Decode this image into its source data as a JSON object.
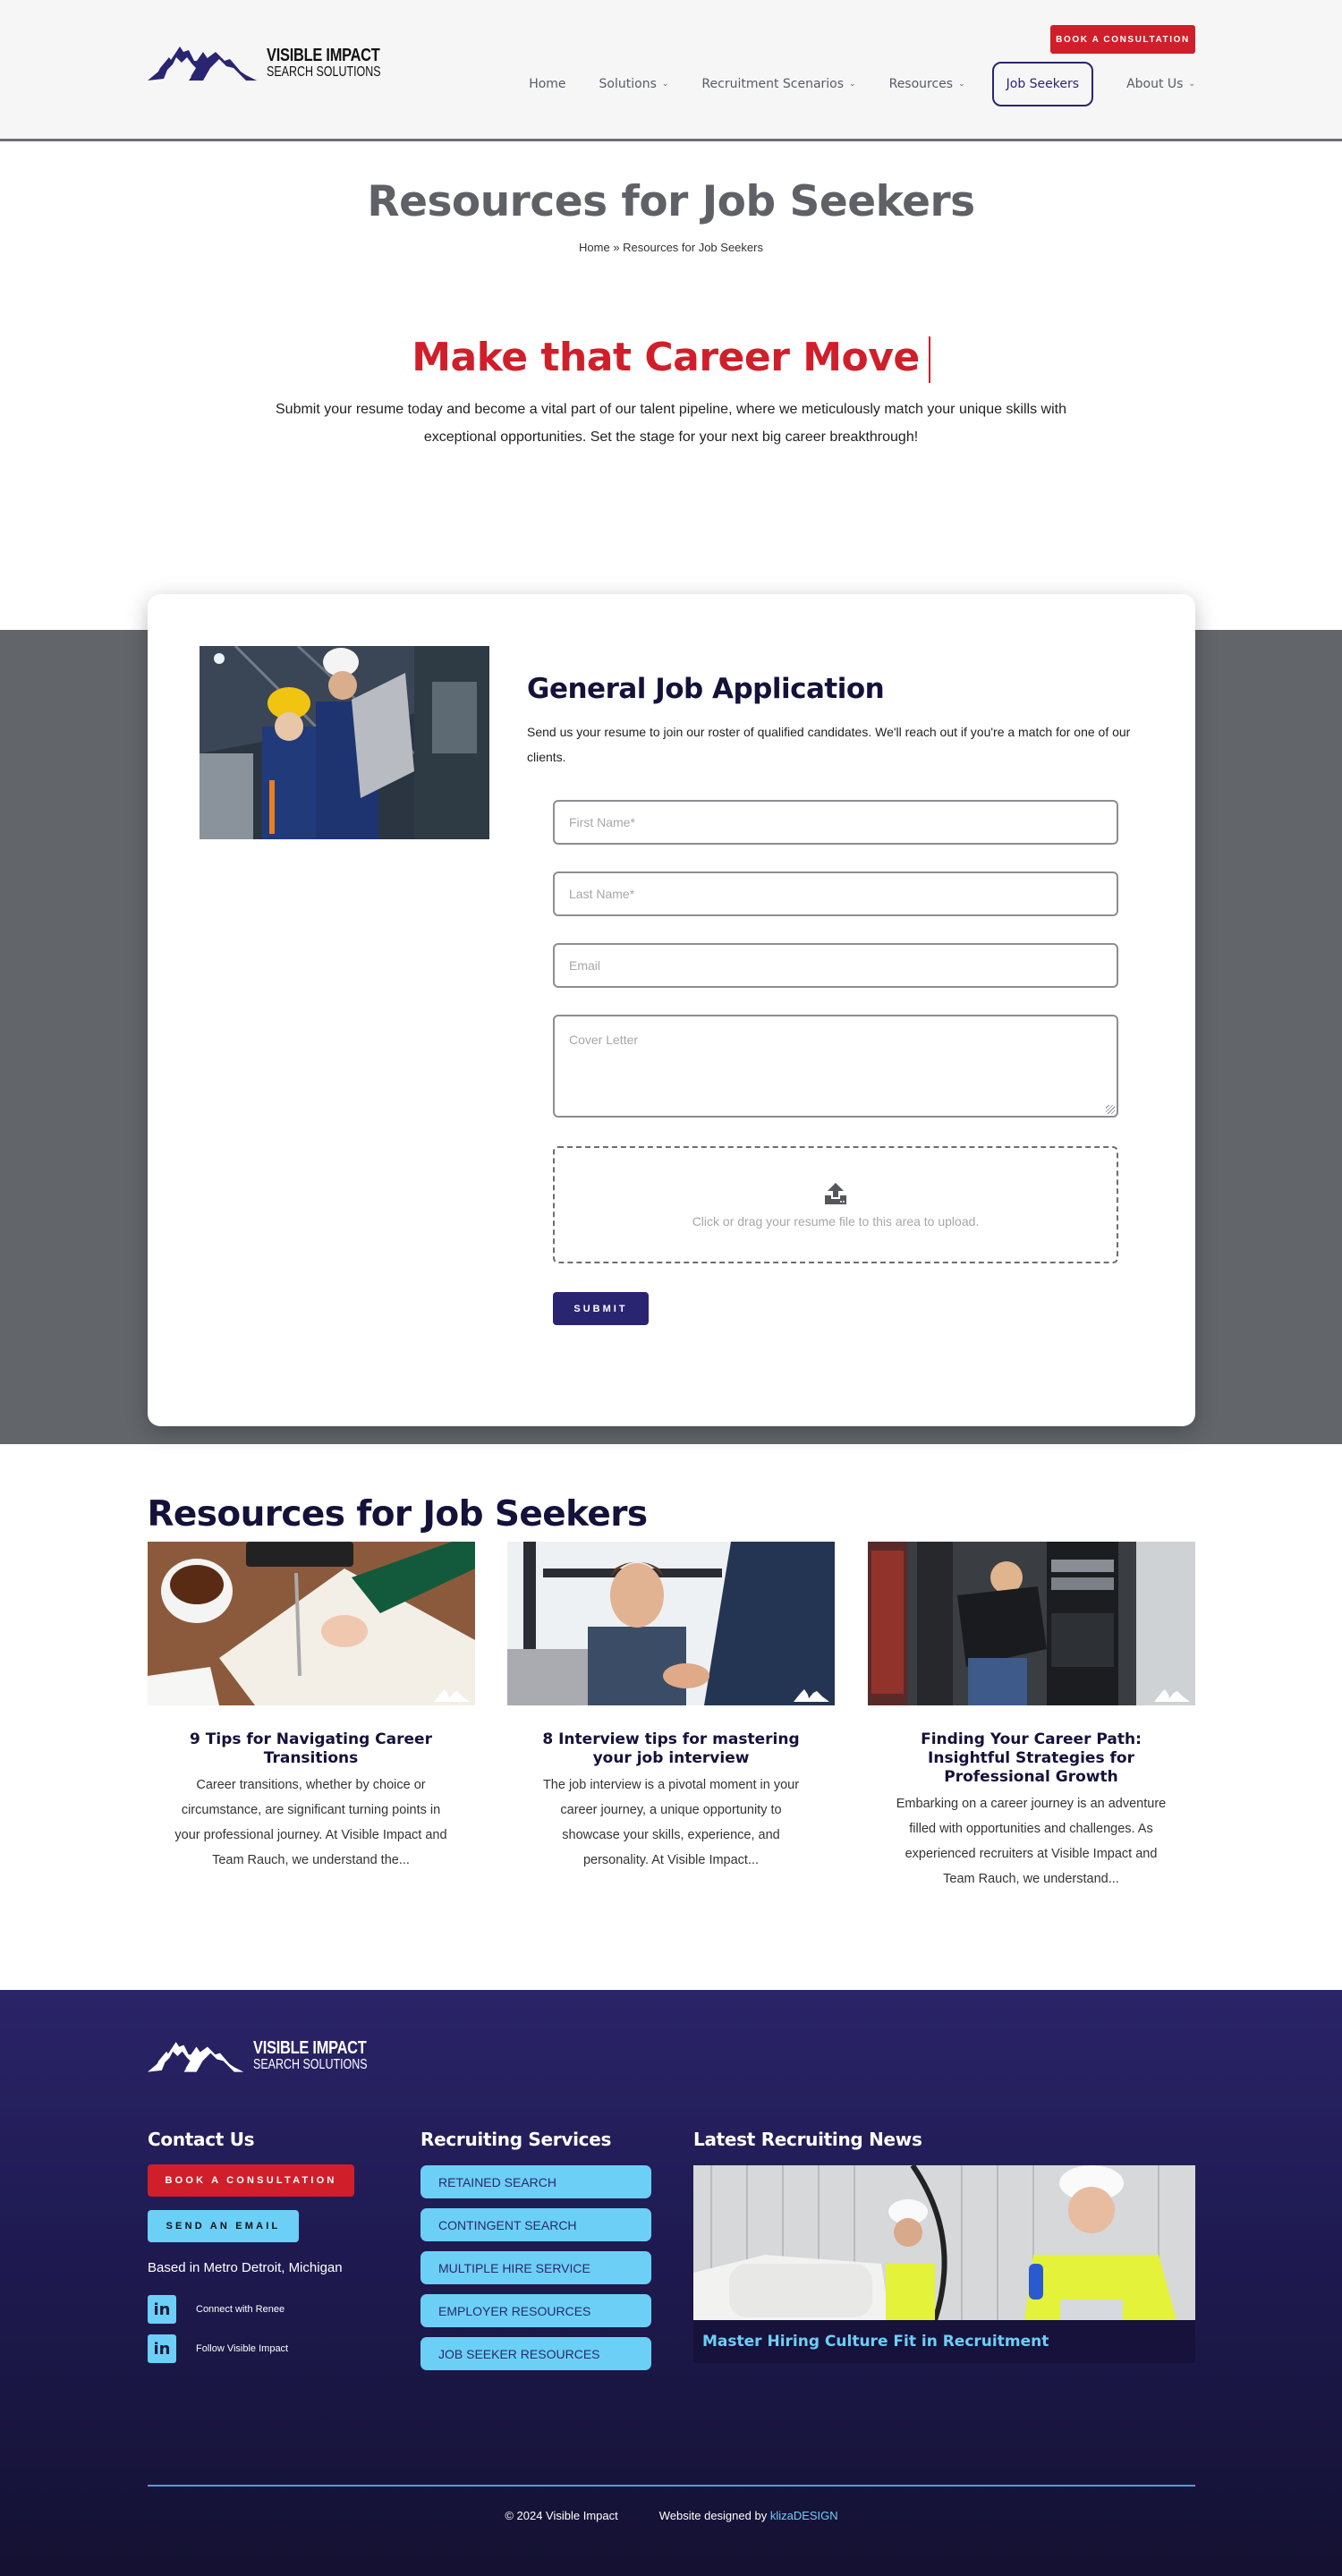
{
  "header": {
    "logo": {
      "line1": "VISIBLE IMPACT",
      "line2": "SEARCH SOLUTIONS"
    },
    "book_button": "BOOK A CONSULTATION",
    "nav": [
      {
        "label": "Home",
        "dropdown": false,
        "active": false
      },
      {
        "label": "Solutions",
        "dropdown": true,
        "active": false
      },
      {
        "label": "Recruitment Scenarios",
        "dropdown": true,
        "active": false
      },
      {
        "label": "Resources",
        "dropdown": true,
        "active": false
      },
      {
        "label": "Job Seekers",
        "dropdown": false,
        "active": true
      },
      {
        "label": "About Us",
        "dropdown": true,
        "active": false
      }
    ]
  },
  "page": {
    "title": "Resources for Job Seekers",
    "breadcrumb": {
      "home": "Home",
      "separator": " » ",
      "current": "Resources for Job Seekers"
    }
  },
  "hero": {
    "heading": "Make that Career Move",
    "text": "Submit your resume today and become a vital part of our talent pipeline, where we meticulously match your unique skills with exceptional opportunities. Set the stage for your next big career breakthrough!"
  },
  "form": {
    "image_alt": "Two engineers in hard hats reviewing a laptop in a factory",
    "title": "General Job Application",
    "description": "Send us your resume to join our roster of qualified candidates. We'll reach out if you're a match for one of our clients.",
    "fields": {
      "first_name": {
        "placeholder": "First Name*",
        "value": ""
      },
      "last_name": {
        "placeholder": "Last Name*",
        "value": ""
      },
      "email": {
        "placeholder": "Email",
        "value": ""
      },
      "cover_letter": {
        "placeholder": "Cover Letter",
        "value": ""
      }
    },
    "upload_text": "Click or drag your resume file to this area to upload.",
    "submit_label": "SUBMIT"
  },
  "resources": {
    "heading": "Resources for Job Seekers",
    "cards": [
      {
        "image_alt": "Hand writing in a notebook next to a cup of tea",
        "title": "9 Tips for Navigating Career Transitions",
        "excerpt": "Career transitions, whether by choice or circumstance, are significant turning points in your professional journey. At Visible Impact and Team Rauch, we understand the..."
      },
      {
        "image_alt": "Smiling man shaking hands at a job interview",
        "title": "8 Interview tips for mastering your job interview",
        "excerpt": "The job interview is a pivotal moment in your career journey, a unique opportunity to showcase your skills, experience, and personality. At Visible Impact..."
      },
      {
        "image_alt": "Technician working on a server rack in a data center",
        "title": "Finding Your Career Path: Insightful Strategies for Professional Growth",
        "excerpt": "Embarking on a career journey is an adventure filled with opportunities and challenges. As experienced recruiters at Visible Impact and Team Rauch, we understand..."
      }
    ]
  },
  "footer": {
    "logo": {
      "line1": "VISIBLE IMPACT",
      "line2": "SEARCH SOLUTIONS"
    },
    "contact": {
      "heading": "Contact Us",
      "book_button": "BOOK A CONSULTATION",
      "email_button": "SEND AN EMAIL",
      "location": "Based in Metro Detroit, Michigan",
      "social": [
        {
          "icon": "linkedin-icon",
          "glyph": "in",
          "label": "Connect with Renee"
        },
        {
          "icon": "linkedin-icon",
          "glyph": "in",
          "label": "Follow Visible Impact"
        }
      ]
    },
    "services": {
      "heading": "Recruiting Services",
      "items": [
        "RETAINED SEARCH",
        "CONTINGENT SEARCH",
        "MULTIPLE HIRE SERVICE",
        "EMPLOYER RESOURCES",
        "JOB SEEKER RESOURCES"
      ]
    },
    "news": {
      "heading": "Latest Recruiting News",
      "image_alt": "Smiling factory workers in hard hats and safety vests",
      "title": "Master Hiring Culture Fit in Recruitment"
    },
    "copyright": "© 2024 Visible Impact",
    "designed_by": "Website designed by ",
    "designer": "klizaDESIGN"
  },
  "colors": {
    "brand_navy": "#2a2570",
    "brand_red": "#d01f2a",
    "accent_light_blue": "#6ccff6",
    "section_gray": "#62656a"
  }
}
